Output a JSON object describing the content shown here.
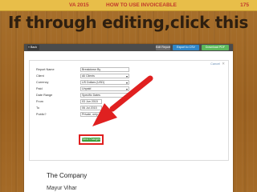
{
  "header": {
    "left": "VA 2015",
    "center": "HOW TO USE INVOICEABLE",
    "page_number": "175"
  },
  "headline": "If through editing,click this",
  "toolbar": {
    "back": "« Back",
    "edit": "Edit Report",
    "export_csv": "Export to CSV",
    "download_pdf": "Download PDF"
  },
  "form": {
    "cancel": "Cancel",
    "fields": [
      {
        "label": "Report Name",
        "value": "Breakdown By"
      },
      {
        "label": "Client",
        "value": "All Clients"
      },
      {
        "label": "Currency",
        "value": "US Dollars (USD)"
      },
      {
        "label": "Paid",
        "value": "Unpaid"
      },
      {
        "label": "Date Range",
        "value": "Specific Dates"
      },
      {
        "label": "From",
        "value": "03 Jun 2015"
      },
      {
        "label": "To",
        "value": "06 Jul 2015"
      },
      {
        "label": "Public?",
        "value": "Private, only viewed b..."
      }
    ],
    "submit": "Send Changes"
  },
  "company": "The Company",
  "company_sub": "Mayur Vihar",
  "colors": {
    "header_band": "#e8be49",
    "header_text": "#c0392b",
    "arrow": "#e02020",
    "submit": "#3a9f3a"
  }
}
